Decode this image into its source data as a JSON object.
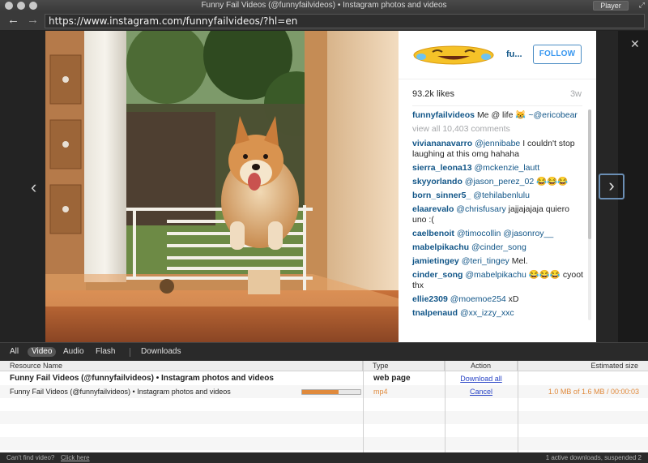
{
  "window": {
    "title": "Funny Fail Videos (@funnyfailvideos) • Instagram photos and videos",
    "player_label": "Player"
  },
  "urlbar": {
    "url": "https://www.instagram.com/funnyfailvideos/?hl=en"
  },
  "post": {
    "username": "fu...",
    "follow_label": "FOLLOW",
    "likes": "93.2k likes",
    "age": "3w",
    "caption_user": "funnyfailvideos",
    "caption_text": "Me @ life 😹",
    "caption_mention": "~@ericobear",
    "view_all": "view all 10,403 comments",
    "comments": [
      {
        "user": "viviananavarro",
        "text": "I couldn't stop laughing at this omg hahaha",
        "mention": "@jennibabe"
      },
      {
        "user": "sierra_leona13",
        "text": "",
        "mention": "@mckenzie_lautt"
      },
      {
        "user": "skyyorlando",
        "text": "",
        "mention": "@jason_perez_02 😂😂😂"
      },
      {
        "user": "born_sinner5_",
        "text": "",
        "mention": "@tehilabenlulu"
      },
      {
        "user": "elaarevalo",
        "text": "jajjajajaja quiero uno :(",
        "mention": "@chrisfusary"
      },
      {
        "user": "caelbenoit",
        "text": "",
        "mention": "@timocollin @jasonroy__"
      },
      {
        "user": "mabelpikachu",
        "text": "",
        "mention": "@cinder_song"
      },
      {
        "user": "jamietingey",
        "text": "Mel.",
        "mention": "@teri_tingey"
      },
      {
        "user": "cinder_song",
        "text": "😂😂😂 cyoot thx",
        "mention": "@mabelpikachu"
      },
      {
        "user": "ellie2309",
        "text": "xD",
        "mention": "@moemoe254"
      },
      {
        "user": "tnalpenaud",
        "text": "",
        "mention": "@xx_izzy_xxc"
      }
    ]
  },
  "downloads": {
    "tabs": [
      "All",
      "Video",
      "Audio",
      "Flash"
    ],
    "active_tab": "Video",
    "downloads_label": "Downloads",
    "columns": {
      "name": "Resource Name",
      "type": "Type",
      "action": "Action",
      "size": "Estimated size"
    },
    "rows": [
      {
        "name": "Funny Fail Videos (@funnyfailvideos) • Instagram photos and videos",
        "type": "web page",
        "action": "Download all",
        "size": "",
        "bold": true
      },
      {
        "name": "Funny Fail Videos (@funnyfailvideos) • Instagram photos and videos",
        "type": "mp4",
        "action": "Cancel",
        "size": "1.0 MB of 1.6 MB / 00:00:03",
        "progress": 0.62,
        "bold": false
      }
    ],
    "status_left": "Can't find video?",
    "status_link": "Click here",
    "status_right": "1 active downloads, suspended 2"
  },
  "colors": {
    "link": "#125688",
    "follow": "#3897f0",
    "progress": "#e08a3c"
  },
  "icons": {
    "back": "arrow-left-icon",
    "forward": "arrow-right-icon",
    "prev": "chevron-left-icon",
    "next": "chevron-right-icon",
    "close": "close-icon"
  }
}
